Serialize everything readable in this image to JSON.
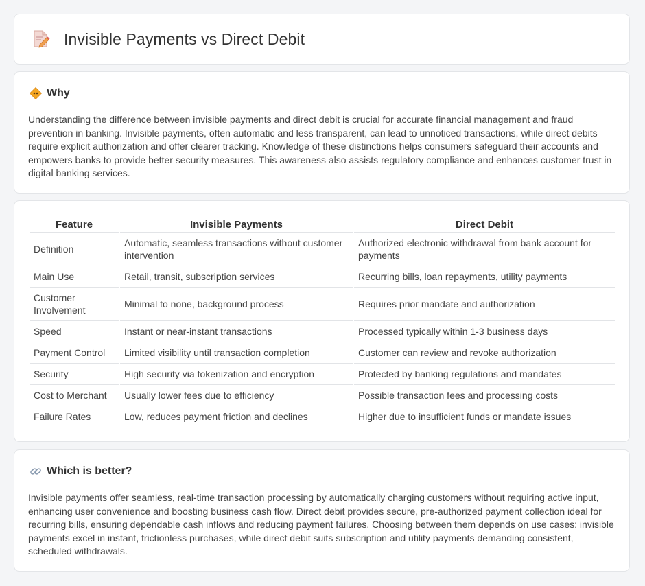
{
  "header": {
    "title": "Invisible Payments vs Direct Debit",
    "icon": "document-pencil-icon"
  },
  "why": {
    "icon": "sign-icon",
    "title": "Why",
    "text": "Understanding the difference between invisible payments and direct debit is crucial for accurate financial management and fraud prevention in banking. Invisible payments, often automatic and less transparent, can lead to unnoticed transactions, while direct debits require explicit authorization and offer clearer tracking. Knowledge of these distinctions helps consumers safeguard their accounts and empowers banks to provide better security measures. This awareness also assists regulatory compliance and enhances customer trust in digital banking services."
  },
  "comparison": {
    "headers": [
      "Feature",
      "Invisible Payments",
      "Direct Debit"
    ],
    "rows": [
      [
        "Definition",
        "Automatic, seamless transactions without customer intervention",
        "Authorized electronic withdrawal from bank account for payments"
      ],
      [
        "Main Use",
        "Retail, transit, subscription services",
        "Recurring bills, loan repayments, utility payments"
      ],
      [
        "Customer Involvement",
        "Minimal to none, background process",
        "Requires prior mandate and authorization"
      ],
      [
        "Speed",
        "Instant or near-instant transactions",
        "Processed typically within 1-3 business days"
      ],
      [
        "Payment Control",
        "Limited visibility until transaction completion",
        "Customer can review and revoke authorization"
      ],
      [
        "Security",
        "High security via tokenization and encryption",
        "Protected by banking regulations and mandates"
      ],
      [
        "Cost to Merchant",
        "Usually lower fees due to efficiency",
        "Possible transaction fees and processing costs"
      ],
      [
        "Failure Rates",
        "Low, reduces payment friction and declines",
        "Higher due to insufficient funds or mandate issues"
      ]
    ]
  },
  "better": {
    "icon": "link-icon",
    "title": "Which is better?",
    "text": "Invisible payments offer seamless, real-time transaction processing by automatically charging customers without requiring active input, enhancing user convenience and boosting business cash flow. Direct debit provides secure, pre-authorized payment collection ideal for recurring bills, ensuring dependable cash inflows and reducing payment failures. Choosing between them depends on use cases: invisible payments excel in instant, frictionless purchases, while direct debit suits subscription and utility payments demanding consistent, scheduled withdrawals."
  }
}
